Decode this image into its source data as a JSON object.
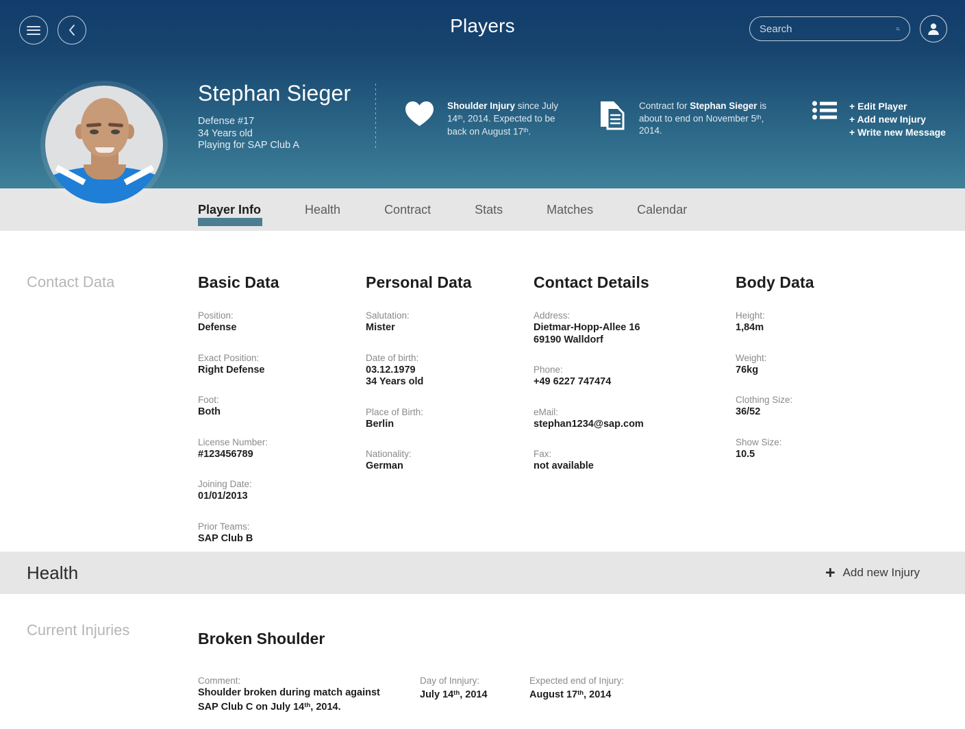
{
  "topbar": {
    "menu_icon": "hamburger-menu-icon",
    "back_icon": "chevron-left-icon",
    "title": "Players",
    "search_placeholder": "Search",
    "search_value": "",
    "search_icon": "search-icon",
    "user_icon": "user-avatar-icon"
  },
  "player": {
    "name": "Stephan Sieger",
    "position_number": "Defense #17",
    "age": "34 Years old",
    "club": "Playing for SAP Club A",
    "photo_alt": "player-portrait"
  },
  "hero_cards": {
    "injury": {
      "icon": "heart-icon",
      "bold": "Shoulder Injury",
      "rest_1": " since July 14",
      "sup_1": "th",
      "rest_2": ", 2014. Expected to be back on August 17",
      "sup_2": "th",
      "rest_3": "."
    },
    "contract": {
      "icon": "document-icon",
      "pre": "Contract for ",
      "bold": "Stephan Sieger",
      "rest_1": " is about to end on November 5",
      "sup_1": "th",
      "rest_2": ", 2014."
    },
    "actions": {
      "icon": "bullet-list-icon",
      "items": [
        "+ Edit Player",
        "+ Add new Injury",
        "+ Write new Message"
      ]
    }
  },
  "tabs": [
    {
      "label": "Player Info",
      "active": true
    },
    {
      "label": "Health",
      "active": false
    },
    {
      "label": "Contract",
      "active": false
    },
    {
      "label": "Stats",
      "active": false
    },
    {
      "label": "Matches",
      "active": false
    },
    {
      "label": "Calendar",
      "active": false
    }
  ],
  "contact_data": {
    "section_label": "Contact Data",
    "columns": [
      {
        "title": "Basic Data",
        "fields": [
          {
            "label": "Position:",
            "value": "Defense"
          },
          {
            "label": "Exact Position:",
            "value": "Right Defense"
          },
          {
            "label": "Foot:",
            "value": "Both"
          },
          {
            "label": "License Number:",
            "value": "#123456789"
          },
          {
            "label": "Joining Date:",
            "value": "01/01/2013"
          },
          {
            "label": "Prior Teams:",
            "value": "SAP Club B"
          }
        ]
      },
      {
        "title": "Personal Data",
        "fields": [
          {
            "label": "Salutation:",
            "value": "Mister"
          },
          {
            "label": "Date of birth:",
            "value": "03.12.1979\n34 Years old"
          },
          {
            "label": "Place of Birth:",
            "value": "Berlin"
          },
          {
            "label": "Nationality:",
            "value": "German"
          }
        ]
      },
      {
        "title": "Contact Details",
        "fields": [
          {
            "label": "Address:",
            "value": "Dietmar-Hopp-Allee 16\n69190 Walldorf"
          },
          {
            "label": "Phone:",
            "value": "+49 6227 747474"
          },
          {
            "label": "eMail:",
            "value": "stephan1234@sap.com"
          },
          {
            "label": "Fax:",
            "value": "not available"
          }
        ]
      },
      {
        "title": "Body Data",
        "fields": [
          {
            "label": "Height:",
            "value": "1,84m"
          },
          {
            "label": "Weight:",
            "value": "76kg"
          },
          {
            "label": "Clothing Size:",
            "value": "36/52"
          },
          {
            "label": "Show Size:",
            "value": "10.5"
          }
        ]
      }
    ]
  },
  "health": {
    "title": "Health",
    "add_button": "Add new Injury",
    "plus_icon": "plus-icon",
    "section_label": "Current Injuries",
    "injury_title": "Broken Shoulder",
    "comment_label": "Comment:",
    "comment_line1": "Shoulder broken during match against",
    "comment_line2_pre": "SAP Club C on July 14",
    "comment_line2_sup": "th",
    "comment_line2_post": ", 2014.",
    "day_label": "Day of Innjury:",
    "day_pre": "July 14",
    "day_sup": "th",
    "day_post": ", 2014",
    "end_label": "Expected end of Injury:",
    "end_pre": "August 17",
    "end_sup": "th",
    "end_post": ", 2014"
  },
  "colors": {
    "header_top": "#123c6b",
    "header_bottom": "#3e8099",
    "tab_accent": "#4b7e92",
    "tabbar_bg": "#e6e6e6",
    "label_gray": "#8a8a8a",
    "section_label_gray": "#b6b6b6"
  }
}
